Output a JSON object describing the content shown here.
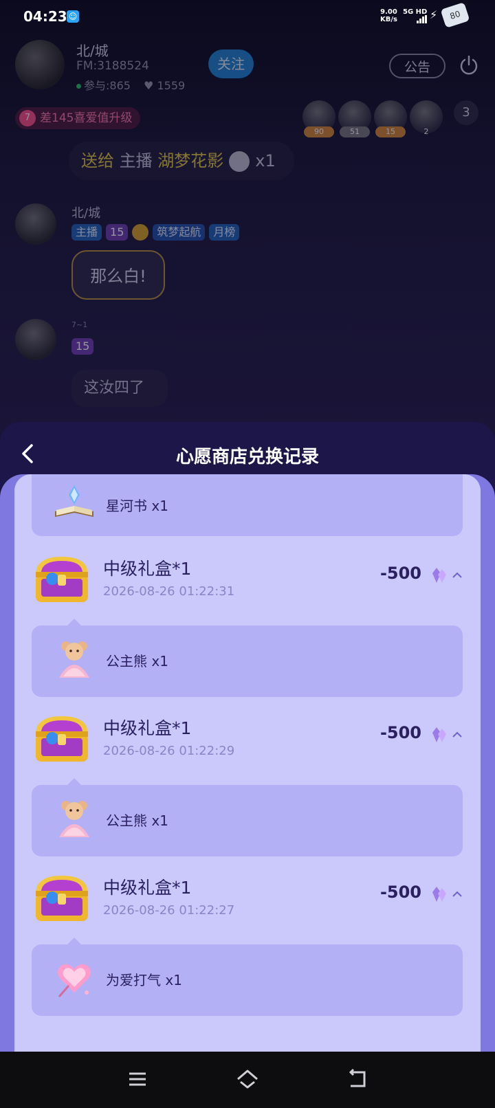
{
  "status_bar": {
    "time": "04:23",
    "speed_value": "9.00",
    "speed_unit": "KB/s",
    "network": "5G HD",
    "battery": "80"
  },
  "room": {
    "host_name": "北/城",
    "fm": "FM:3188524",
    "participants": "参与:865",
    "likes": "1559",
    "follow_label": "关注",
    "notice_label": "公告",
    "level": "7",
    "level_text": "差145喜爱值升级",
    "viewers": [
      {
        "tag": "90"
      },
      {
        "tag": "51"
      },
      {
        "tag": "15"
      },
      {
        "tag": "2"
      }
    ],
    "viewer_count": "3",
    "gift_msg": {
      "prefix": "送给",
      "role": "主播",
      "target": "湖梦花影",
      "qty": "x1"
    },
    "chat": [
      {
        "name": "北/城",
        "tags": [
          "主播",
          "15",
          "筑梦起航",
          "月榜"
        ],
        "message": "那么白!"
      },
      {
        "name": "7~1",
        "tags": [
          "15"
        ],
        "message": "这汝四了"
      }
    ]
  },
  "sheet": {
    "title": "心愿商店兑换记录",
    "first_item": {
      "label": "星河书 x1"
    },
    "records": [
      {
        "title": "中级礼盒*1",
        "time": "2026-08-26 01:22:31",
        "cost": "-500",
        "item": "公主熊 x1",
        "item_icon": "teddy-bear-icon"
      },
      {
        "title": "中级礼盒*1",
        "time": "2026-08-26 01:22:29",
        "cost": "-500",
        "item": "公主熊 x1",
        "item_icon": "teddy-bear-icon"
      },
      {
        "title": "中级礼盒*1",
        "time": "2026-08-26 01:22:27",
        "cost": "-500",
        "item": "为爱打气 x1",
        "item_icon": "heart-wand-icon"
      }
    ]
  },
  "colors": {
    "sheet_bg": "#1d1648",
    "panel": "#7f78e0",
    "card": "#cbc8fb",
    "sub_card": "#b3b0f5",
    "text_dark": "#2a2060"
  }
}
